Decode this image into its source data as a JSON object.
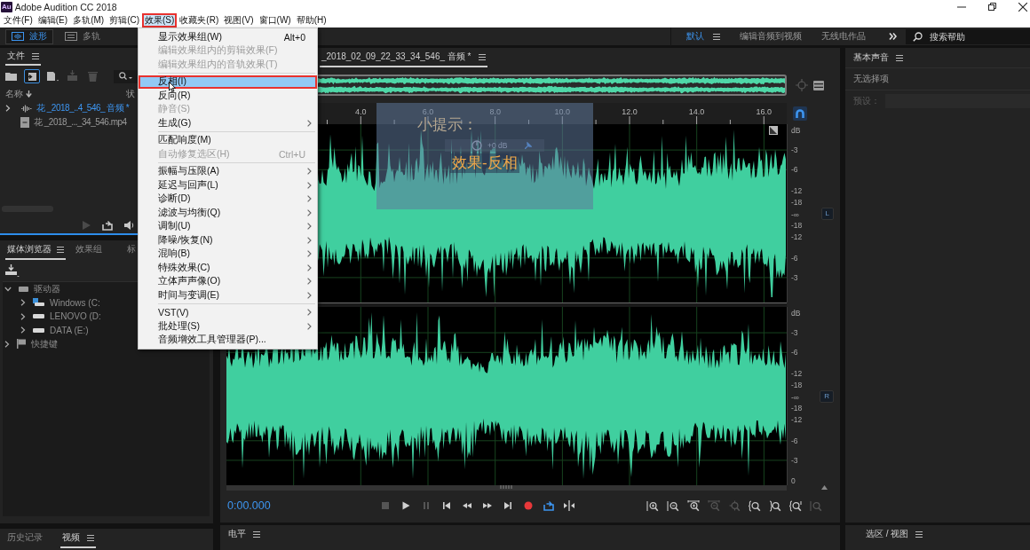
{
  "window": {
    "app_icon": "Au",
    "title": "Adobe Audition CC 2018"
  },
  "menu_bar": [
    {
      "label": "文件(F)",
      "selected": false,
      "marked": false
    },
    {
      "label": "编辑(E)",
      "selected": false,
      "marked": false
    },
    {
      "label": "多轨(M)",
      "selected": false,
      "marked": false
    },
    {
      "label": "剪辑(C)",
      "selected": false,
      "marked": false
    },
    {
      "label": "效果(S)",
      "selected": true,
      "marked": true
    },
    {
      "label": "收藏夹(R)",
      "selected": false,
      "marked": false
    },
    {
      "label": "视图(V)",
      "selected": false,
      "marked": false
    },
    {
      "label": "窗口(W)",
      "selected": false,
      "marked": false
    },
    {
      "label": "帮助(H)",
      "selected": false,
      "marked": false
    }
  ],
  "effects_menu": [
    {
      "kind": "item",
      "label": "显示效果组(W)",
      "shortcut": "Alt+0",
      "submenu": false,
      "disabled": false,
      "selected": false,
      "marked": false
    },
    {
      "kind": "item",
      "label": "编辑效果组内的剪辑效果(F)",
      "submenu": false,
      "disabled": true,
      "selected": false,
      "marked": false
    },
    {
      "kind": "item",
      "label": "编辑效果组内的音轨效果(T)",
      "submenu": false,
      "disabled": true,
      "selected": false,
      "marked": false
    },
    {
      "kind": "separator"
    },
    {
      "kind": "item",
      "label": "反相(I)",
      "submenu": false,
      "disabled": false,
      "selected": true,
      "marked": true
    },
    {
      "kind": "item",
      "label": "反向(R)",
      "submenu": false,
      "disabled": false,
      "selected": false,
      "marked": false
    },
    {
      "kind": "item",
      "label": "静音(S)",
      "submenu": false,
      "disabled": true,
      "selected": false,
      "marked": false
    },
    {
      "kind": "item",
      "label": "生成(G)",
      "submenu": true,
      "disabled": false,
      "selected": false,
      "marked": false
    },
    {
      "kind": "separator"
    },
    {
      "kind": "item",
      "label": "匹配响度(M)",
      "submenu": false,
      "disabled": false,
      "selected": false,
      "marked": false
    },
    {
      "kind": "item",
      "label": "自动修复选区(H)",
      "shortcut": "Ctrl+U",
      "submenu": false,
      "disabled": true,
      "selected": false,
      "marked": false
    },
    {
      "kind": "separator"
    },
    {
      "kind": "item",
      "label": "振幅与压限(A)",
      "submenu": true,
      "disabled": false,
      "selected": false,
      "marked": false
    },
    {
      "kind": "item",
      "label": "延迟与回声(L)",
      "submenu": true,
      "disabled": false,
      "selected": false,
      "marked": false
    },
    {
      "kind": "item",
      "label": "诊断(D)",
      "submenu": true,
      "disabled": false,
      "selected": false,
      "marked": false
    },
    {
      "kind": "item",
      "label": "滤波与均衡(Q)",
      "submenu": true,
      "disabled": false,
      "selected": false,
      "marked": false
    },
    {
      "kind": "item",
      "label": "调制(U)",
      "submenu": true,
      "disabled": false,
      "selected": false,
      "marked": false
    },
    {
      "kind": "item",
      "label": "降噪/恢复(N)",
      "submenu": true,
      "disabled": false,
      "selected": false,
      "marked": false
    },
    {
      "kind": "item",
      "label": "混响(B)",
      "submenu": true,
      "disabled": false,
      "selected": false,
      "marked": false
    },
    {
      "kind": "item",
      "label": "特殊效果(C)",
      "submenu": true,
      "disabled": false,
      "selected": false,
      "marked": false
    },
    {
      "kind": "item",
      "label": "立体声声像(O)",
      "submenu": true,
      "disabled": false,
      "selected": false,
      "marked": false
    },
    {
      "kind": "item",
      "label": "时间与变调(E)",
      "submenu": true,
      "disabled": false,
      "selected": false,
      "marked": false
    },
    {
      "kind": "separator"
    },
    {
      "kind": "item",
      "label": "VST(V)",
      "submenu": true,
      "disabled": false,
      "selected": false,
      "marked": false
    },
    {
      "kind": "item",
      "label": "批处理(S)",
      "submenu": true,
      "disabled": false,
      "selected": false,
      "marked": false
    },
    {
      "kind": "item",
      "label": "音频增效工具管理器(P)...",
      "submenu": false,
      "disabled": false,
      "selected": false,
      "marked": false
    }
  ],
  "toolbar": {
    "views": [
      {
        "label": "波形",
        "kind": "waveform",
        "selected": true
      },
      {
        "label": "多轨",
        "kind": "multitrack",
        "selected": false
      }
    ],
    "workspaces": [
      {
        "label": "默认",
        "selected": true
      },
      {
        "label": "编辑音频到视频",
        "selected": false
      },
      {
        "label": "无线电作品",
        "selected": false
      }
    ],
    "search": {
      "placeholder": "搜索帮助"
    }
  },
  "files_panel": {
    "tabs": [
      {
        "label": "文件",
        "selected": true
      }
    ],
    "tools": [
      {
        "kind": "open",
        "disabled": false,
        "selected": false
      },
      {
        "kind": "import",
        "disabled": false,
        "selected": true
      },
      {
        "kind": "new",
        "disabled": false,
        "selected": false
      },
      {
        "kind": "insert",
        "disabled": true,
        "selected": false
      },
      {
        "kind": "delete",
        "disabled": true,
        "selected": false
      }
    ],
    "columns": [
      "名称",
      "状"
    ],
    "items": [
      {
        "name": "花 _2018_..4_546_ 音频 *",
        "kind": "audio",
        "expanded": false,
        "selected": true
      },
      {
        "name": "花 _2018_..._34_546.mp4",
        "kind": "video",
        "selected": false
      }
    ],
    "preview_tools": [
      {
        "kind": "play",
        "disabled": true
      },
      {
        "kind": "loop",
        "disabled": false
      },
      {
        "kind": "volume",
        "disabled": false
      }
    ]
  },
  "media_panel": {
    "tabs": [
      {
        "label": "媒体浏览器",
        "selected": true
      },
      {
        "label": "效果组",
        "selected": false
      },
      {
        "label": "标",
        "selected": false
      }
    ],
    "tree": [
      {
        "label": "驱动器",
        "kind": "drives",
        "expanded": true,
        "children": [
          {
            "label": "Windows (C:",
            "kind": "system-drive",
            "expanded": false
          },
          {
            "label": "LENOVO (D:",
            "kind": "drive",
            "expanded": false
          },
          {
            "label": "DATA (E:)",
            "kind": "drive",
            "expanded": false
          }
        ]
      },
      {
        "label": "快捷键",
        "kind": "shortcuts",
        "expanded": false
      }
    ]
  },
  "history_panel": {
    "tabs": [
      {
        "label": "历史记录",
        "selected": false
      },
      {
        "label": "视频",
        "selected": true
      }
    ]
  },
  "editor": {
    "tabs": [
      {
        "label": "_2018_02_09_22_33_34_546_ 音频 *",
        "selected": true
      }
    ],
    "snap_on": true,
    "ruler": [
      "4.0",
      "6.0",
      "8.0",
      "10.0",
      "12.0",
      "14.0",
      "16.0"
    ],
    "channels": [
      {
        "badge": "L",
        "scale": [
          "dB",
          "-3",
          "-6",
          "-12",
          "-18",
          "-∞",
          "-18",
          "-12",
          "-6",
          "-3"
        ]
      },
      {
        "badge": "R",
        "scale": [
          "dB",
          "-3",
          "-6",
          "-12",
          "-18",
          "-∞",
          "-18",
          "-12",
          "-6",
          "-3",
          "0"
        ]
      }
    ],
    "hint": {
      "title": "小提示：",
      "text": "效果-反相"
    },
    "hud": {
      "reading": "+0 dB"
    },
    "time": "0:00.000",
    "transport": [
      {
        "kind": "stop",
        "disabled": true,
        "on": false
      },
      {
        "kind": "play",
        "disabled": false,
        "on": false
      },
      {
        "kind": "pause",
        "disabled": true,
        "on": false
      },
      {
        "kind": "previous",
        "disabled": false,
        "on": false
      },
      {
        "kind": "rewind",
        "disabled": false,
        "on": false
      },
      {
        "kind": "fast-forward",
        "disabled": false,
        "on": false
      },
      {
        "kind": "next",
        "disabled": false,
        "on": false
      },
      {
        "kind": "record",
        "disabled": false,
        "on": false
      },
      {
        "kind": "loop",
        "disabled": false,
        "on": true
      },
      {
        "kind": "skip-selection",
        "disabled": false,
        "on": false
      }
    ],
    "zoom_tools": [
      {
        "kind": "in-amplitude",
        "disabled": false
      },
      {
        "kind": "out-amplitude",
        "disabled": false
      },
      {
        "kind": "in-time",
        "disabled": false
      },
      {
        "kind": "out-time",
        "disabled": true
      },
      {
        "kind": "full",
        "disabled": true
      },
      {
        "kind": "in-point",
        "disabled": false
      },
      {
        "kind": "out-point",
        "disabled": false
      },
      {
        "kind": "selection",
        "disabled": false
      },
      {
        "kind": "reset",
        "disabled": true
      }
    ]
  },
  "levels_panel": {
    "title": "电平"
  },
  "essential_sound": {
    "title": "基本声音",
    "status": "无选择项",
    "preset": {
      "label": "预设：",
      "disabled": true
    }
  },
  "selection_panel": {
    "title": "选区 / 视图"
  }
}
